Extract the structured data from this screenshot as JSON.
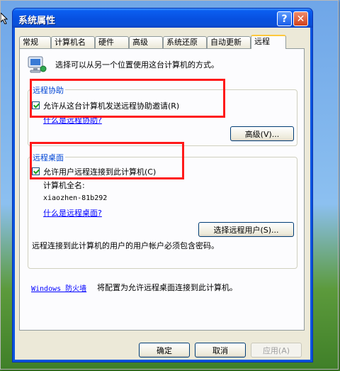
{
  "window": {
    "title": "系统属性",
    "help": "?",
    "close": "✕"
  },
  "tabs": [
    "常规",
    "计算机名",
    "硬件",
    "高级",
    "系统还原",
    "自动更新",
    "远程"
  ],
  "description": "选择可以从另一个位置使用这台计算机的方式。",
  "remote_assistance": {
    "group_title": "远程协助",
    "checkbox_label": "允许从这台计算机发送远程协助邀请(R)",
    "checked": true,
    "link": "什么是远程协助?",
    "advanced_button": "高级(V)..."
  },
  "remote_desktop": {
    "group_title": "远程桌面",
    "checkbox_label": "允许用户远程连接到此计算机(C)",
    "checked": true,
    "computer_name_label": "计算机全名:",
    "computer_name": "xiaozhen-81b292",
    "link": "什么是远程桌面?",
    "select_users_button": "选择远程用户(S)...",
    "note": "远程连接到此计算机的用户的用户帐户必须包含密码。"
  },
  "firewall": {
    "link": "Windows 防火墙",
    "text": "将配置为允许远程桌面连接到此计算机。"
  },
  "footer": {
    "ok": "确定",
    "cancel": "取消",
    "apply": "应用(A)"
  },
  "colors": {
    "titlebar": "#0a54e0",
    "dialog_bg": "#ece9d8",
    "highlight_box": "#ff1a1a",
    "group_title": "#0046d5"
  }
}
